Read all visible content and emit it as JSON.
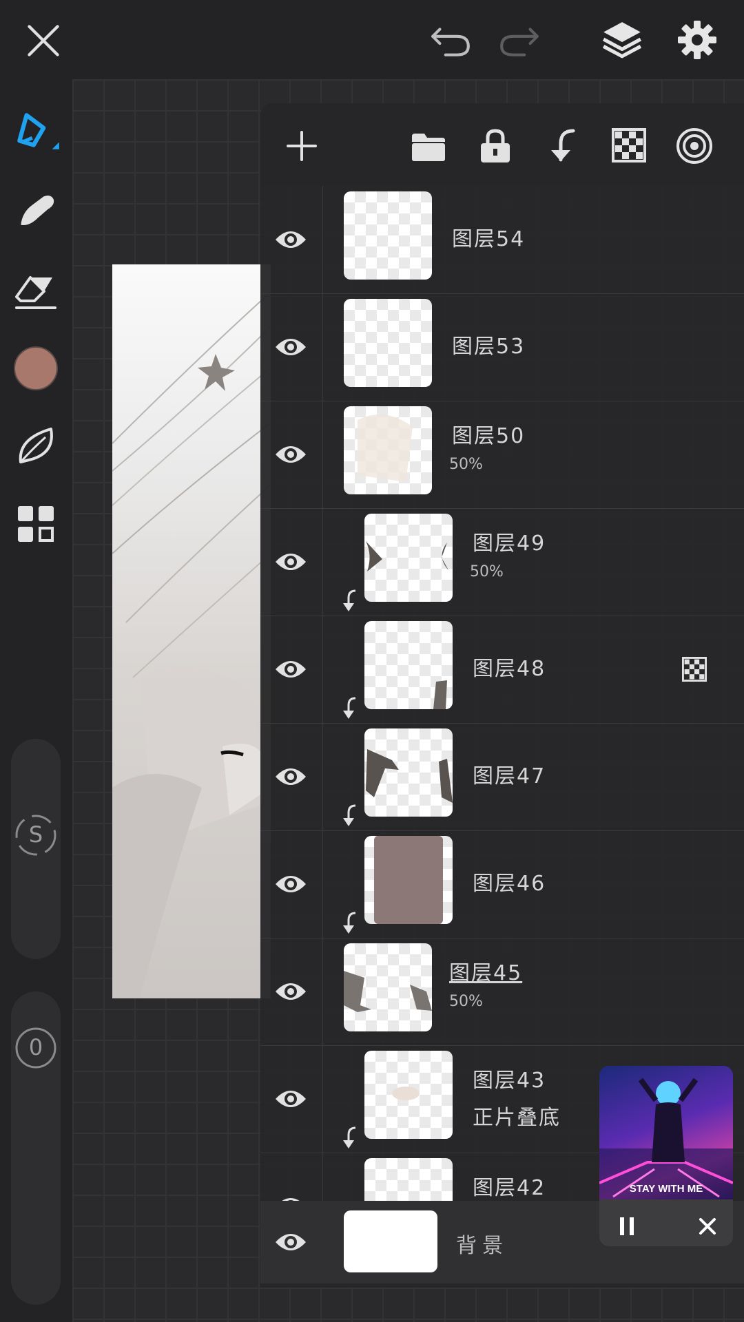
{
  "app": {
    "icons": {
      "close": "close-icon",
      "undo": "undo-icon",
      "redo": "redo-icon",
      "layers": "layers-icon",
      "settings": "gear-icon"
    }
  },
  "toolbar_left": {
    "tools": [
      "pen-icon",
      "smudge-icon",
      "eraser-icon",
      "color-swatch",
      "leaf-icon",
      "gallery-icon"
    ],
    "current_color": "#a8786c",
    "size_label": "S",
    "opacity_label": "0"
  },
  "layers_panel": {
    "actions": [
      "add-layer-icon",
      "folder-icon",
      "lock-icon",
      "merge-down-icon",
      "alpha-lock-icon",
      "target-icon"
    ],
    "layers": [
      {
        "name": "图层54",
        "sub": ""
      },
      {
        "name": "图层53",
        "sub": ""
      },
      {
        "name": "图层50",
        "sub": "50%"
      },
      {
        "name": "图层49",
        "sub": "50%"
      },
      {
        "name": "图层48",
        "sub": ""
      },
      {
        "name": "图层47",
        "sub": ""
      },
      {
        "name": "图层46",
        "sub": ""
      },
      {
        "name": "图层45",
        "sub": "50%"
      },
      {
        "name": "图层43",
        "sub": "正片叠底"
      },
      {
        "name": "图层42",
        "sub": ""
      }
    ],
    "background_label": "背景"
  },
  "player": {
    "title": "STAY WITH ME",
    "pause": "pause-icon",
    "close": "close-icon"
  }
}
